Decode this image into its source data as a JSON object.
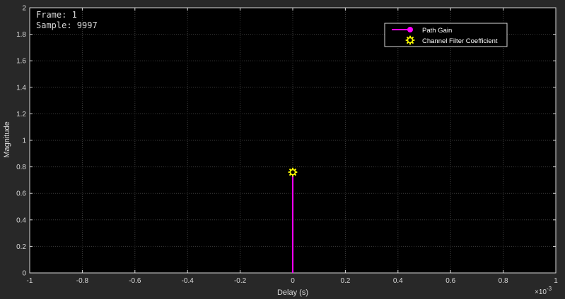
{
  "colors": {
    "figure_bg": "#282828",
    "axes_bg": "#000000",
    "text": "#d9d9d9",
    "grid": "#3c3c3c",
    "path_gain": "#ff00ff",
    "coefficient": "#ffff00"
  },
  "chart_data": {
    "type": "stem",
    "xlabel": "Delay (s)",
    "ylabel": "Magnitude",
    "x_exponent_label": "×10",
    "x_exponent_power": "-3",
    "xlim": [
      -1,
      1
    ],
    "ylim": [
      0,
      2
    ],
    "xticks": [
      -1,
      -0.8,
      -0.6,
      -0.4,
      -0.2,
      0,
      0.2,
      0.4,
      0.6,
      0.8,
      1
    ],
    "xtick_labels": [
      "-1",
      "-0.8",
      "-0.6",
      "-0.4",
      "-0.2",
      "0",
      "0.2",
      "0.4",
      "0.6",
      "0.8",
      "1"
    ],
    "yticks": [
      0,
      0.2,
      0.4,
      0.6,
      0.8,
      1,
      1.2,
      1.4,
      1.6,
      1.8,
      2
    ],
    "ytick_labels": [
      "0",
      "0.2",
      "0.4",
      "0.6",
      "0.8",
      "1",
      "1.2",
      "1.4",
      "1.6",
      "1.8",
      "2"
    ],
    "grid": true,
    "annotation": {
      "frame": "Frame: 1",
      "sample": "Sample: 9997"
    },
    "legend": {
      "placement": "top-right",
      "entries": [
        "Path Gain",
        "Channel Filter Coefficient"
      ]
    },
    "series": [
      {
        "name": "Path Gain",
        "marker": "stem-circle",
        "color": "#ff00ff",
        "points": [
          {
            "x": 0,
            "y": 0.76
          }
        ]
      },
      {
        "name": "Channel Filter Coefficient",
        "marker": "sun",
        "color": "#ffff00",
        "points": [
          {
            "x": 0,
            "y": 0.76
          }
        ]
      }
    ]
  }
}
